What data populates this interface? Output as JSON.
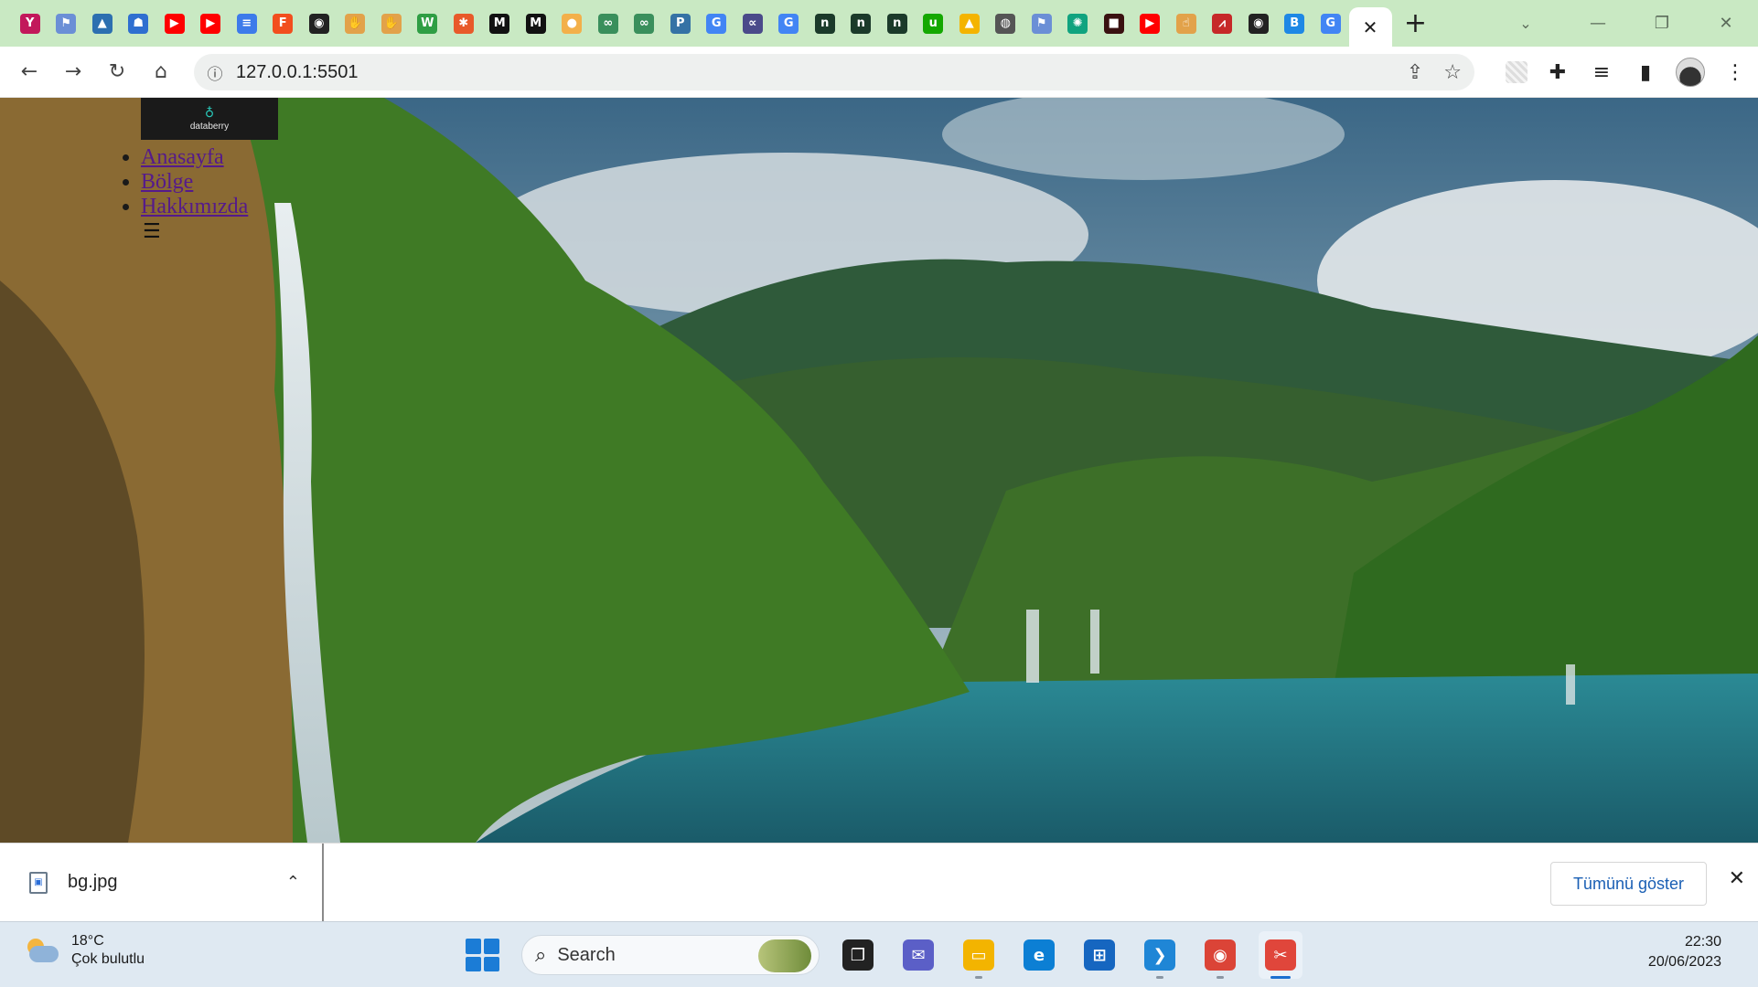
{
  "browser": {
    "tabs": [
      {
        "icon": "yoast-icon",
        "glyph": "Y",
        "color": "#c2185b"
      },
      {
        "icon": "flag-icon",
        "glyph": "⚑",
        "color": "#6b8fd6"
      },
      {
        "icon": "mountain-icon",
        "glyph": "▲",
        "color": "#2c6fb0"
      },
      {
        "icon": "contacts-icon",
        "glyph": "☗",
        "color": "#2f6fd0"
      },
      {
        "icon": "youtube-icon",
        "glyph": "▶",
        "color": "#ff0000"
      },
      {
        "icon": "youtube-icon",
        "glyph": "▶",
        "color": "#ff0000"
      },
      {
        "icon": "docs-icon",
        "glyph": "≡",
        "color": "#3d7bea"
      },
      {
        "icon": "figma-icon",
        "glyph": "F",
        "color": "#f24e1e"
      },
      {
        "icon": "github-icon",
        "glyph": "◉",
        "color": "#222222"
      },
      {
        "icon": "hand-icon",
        "glyph": "✋",
        "color": "#e2a24a"
      },
      {
        "icon": "hand-icon",
        "glyph": "✋",
        "color": "#e2a24a"
      },
      {
        "icon": "w3schools-icon",
        "glyph": "W",
        "color": "#2f9e44"
      },
      {
        "icon": "asterisk-icon",
        "glyph": "✱",
        "color": "#e85a2a"
      },
      {
        "icon": "medium-icon",
        "glyph": "M",
        "color": "#111111"
      },
      {
        "icon": "medium-icon",
        "glyph": "M",
        "color": "#111111"
      },
      {
        "icon": "orange-circle-icon",
        "glyph": "●",
        "color": "#f3b04a"
      },
      {
        "icon": "infinity-icon",
        "glyph": "∞",
        "color": "#3a8f5c"
      },
      {
        "icon": "infinity-icon",
        "glyph": "∞",
        "color": "#3a8f5c"
      },
      {
        "icon": "python-icon",
        "glyph": "P",
        "color": "#3572a5"
      },
      {
        "icon": "google-icon",
        "glyph": "G",
        "color": "#4285f4"
      },
      {
        "icon": "link-icon",
        "glyph": "∝",
        "color": "#4a4a8a"
      },
      {
        "icon": "google-icon",
        "glyph": "G",
        "color": "#4285f4"
      },
      {
        "icon": "ni-icon",
        "glyph": "n",
        "color": "#1b3a2a"
      },
      {
        "icon": "ni-icon",
        "glyph": "n",
        "color": "#1b3a2a"
      },
      {
        "icon": "ni-icon",
        "glyph": "n",
        "color": "#1b3a2a"
      },
      {
        "icon": "upwork-icon",
        "glyph": "u",
        "color": "#14a800"
      },
      {
        "icon": "drive-icon",
        "glyph": "▲",
        "color": "#f4b400"
      },
      {
        "icon": "globe-icon",
        "glyph": "◍",
        "color": "#555555"
      },
      {
        "icon": "flag-icon",
        "glyph": "⚑",
        "color": "#6b8fd6"
      },
      {
        "icon": "openai-icon",
        "glyph": "✺",
        "color": "#10a37f"
      },
      {
        "icon": "dark-app-icon",
        "glyph": "■",
        "color": "#3a1111"
      },
      {
        "icon": "youtube-icon",
        "glyph": "▶",
        "color": "#ff0000"
      },
      {
        "icon": "hand-icon",
        "glyph": "☝",
        "color": "#e2a24a"
      },
      {
        "icon": "ribbon-icon",
        "glyph": "⩘",
        "color": "#c62828"
      },
      {
        "icon": "github-icon",
        "glyph": "◉",
        "color": "#222222"
      },
      {
        "icon": "bootstrap-icon",
        "glyph": "B",
        "color": "#1e88e5"
      },
      {
        "icon": "google-icon",
        "glyph": "G",
        "color": "#4285f4"
      }
    ],
    "active_tab_close": "✕",
    "new_tab": "+",
    "window_controls": {
      "minimize": "—",
      "restore": "❐",
      "close": "✕",
      "tab_search": "⌄"
    },
    "address": {
      "url": "127.0.0.1:5501",
      "info_icon": "ⓘ"
    },
    "colors": {
      "tabstrip": "#c9e9c3",
      "toolbar": "#ffffff",
      "link_visited": "#551a8b"
    }
  },
  "page": {
    "logo_text": "databerry",
    "nav_items": [
      "Anasayfa",
      "Bölge",
      "Hakkımızda"
    ],
    "menu_toggle": "☰"
  },
  "downloads": {
    "file_name": "bg.jpg",
    "show_all": "Tümünü göster"
  },
  "taskbar": {
    "weather_temp": "18°C",
    "weather_condition": "Çok bulutlu",
    "search_placeholder": "Search",
    "time": "22:30",
    "date": "20/06/2023",
    "apps": [
      {
        "name": "task-view",
        "glyph": "❐",
        "color": "#222222",
        "running": false
      },
      {
        "name": "teams-chat",
        "glyph": "✉",
        "color": "#5b5fc7",
        "running": false
      },
      {
        "name": "file-explorer",
        "glyph": "▭",
        "color": "#f3b400",
        "running": true
      },
      {
        "name": "edge",
        "glyph": "e",
        "color": "#0c7fd4",
        "running": false
      },
      {
        "name": "microsoft-store",
        "glyph": "⊞",
        "color": "#1666c0",
        "running": false
      },
      {
        "name": "vscode",
        "glyph": "❯",
        "color": "#1f86d6",
        "running": true
      },
      {
        "name": "chrome",
        "glyph": "◉",
        "color": "#db4437",
        "running": true
      },
      {
        "name": "snipping-tool",
        "glyph": "✂",
        "color": "#e0463b",
        "running": true,
        "active": true
      }
    ]
  }
}
